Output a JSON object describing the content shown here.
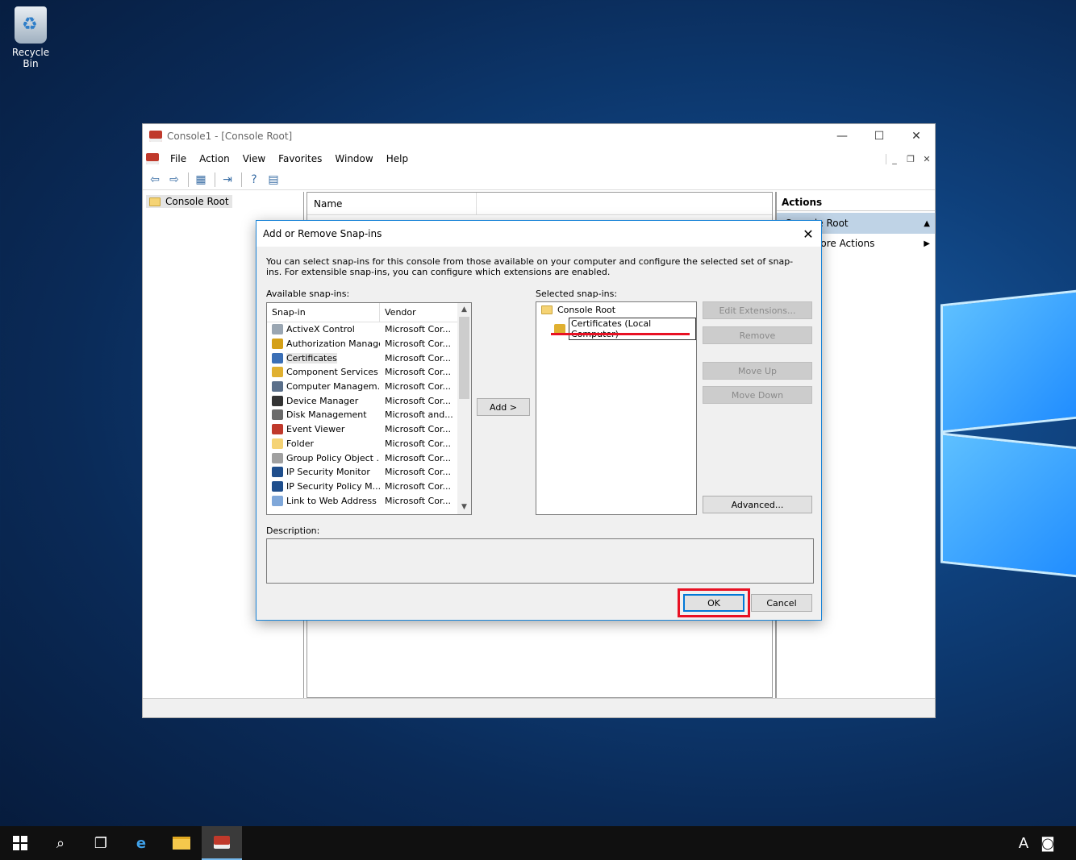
{
  "desktop": {
    "recycle_bin_label": "Recycle Bin"
  },
  "mmc": {
    "title": "Console1 - [Console Root]",
    "window_controls": {
      "minimize": "—",
      "maximize": "☐",
      "close": "✕"
    },
    "menu": [
      "File",
      "Action",
      "View",
      "Favorites",
      "Window",
      "Help"
    ],
    "tree_root": "Console Root",
    "center_column_name": "Name",
    "actions_header": "Actions",
    "actions_section": "Console Root",
    "actions_more": "More Actions"
  },
  "dialog": {
    "title": "Add or Remove Snap-ins",
    "close": "✕",
    "intro": "You can select snap-ins for this console from those available on your computer and configure the selected set of snap-ins. For extensible snap-ins, you can configure which extensions are enabled.",
    "available_label": "Available snap-ins:",
    "selected_label": "Selected snap-ins:",
    "columns": {
      "snapin": "Snap-in",
      "vendor": "Vendor"
    },
    "available": [
      {
        "name": "ActiveX Control",
        "vendor": "Microsoft Cor...",
        "color": "#9aa6b2"
      },
      {
        "name": "Authorization Manager",
        "vendor": "Microsoft Cor...",
        "color": "#d4a017"
      },
      {
        "name": "Certificates",
        "vendor": "Microsoft Cor...",
        "color": "#3b6fb6"
      },
      {
        "name": "Component Services",
        "vendor": "Microsoft Cor...",
        "color": "#e0b030"
      },
      {
        "name": "Computer Managem...",
        "vendor": "Microsoft Cor...",
        "color": "#5a6f8a"
      },
      {
        "name": "Device Manager",
        "vendor": "Microsoft Cor...",
        "color": "#333333"
      },
      {
        "name": "Disk Management",
        "vendor": "Microsoft and...",
        "color": "#6b6b6b"
      },
      {
        "name": "Event Viewer",
        "vendor": "Microsoft Cor...",
        "color": "#c0392b"
      },
      {
        "name": "Folder",
        "vendor": "Microsoft Cor...",
        "color": "#f5d374"
      },
      {
        "name": "Group Policy Object ...",
        "vendor": "Microsoft Cor...",
        "color": "#a0a0a0"
      },
      {
        "name": "IP Security Monitor",
        "vendor": "Microsoft Cor...",
        "color": "#1f4e8c"
      },
      {
        "name": "IP Security Policy M...",
        "vendor": "Microsoft Cor...",
        "color": "#1f4e8c"
      },
      {
        "name": "Link to Web Address",
        "vendor": "Microsoft Cor...",
        "color": "#7fa7d9"
      }
    ],
    "selected_root": "Console Root",
    "selected_child": "Certificates (Local Computer)",
    "buttons": {
      "edit_extensions": "Edit Extensions...",
      "remove": "Remove",
      "move_up": "Move Up",
      "move_down": "Move Down",
      "add": "Add >",
      "advanced": "Advanced...",
      "ok": "OK",
      "cancel": "Cancel"
    },
    "description_label": "Description:"
  },
  "taskbar": {
    "tray_ime": "A"
  },
  "colors": {
    "accent": "#1883d7",
    "highlight": "#e81123"
  }
}
